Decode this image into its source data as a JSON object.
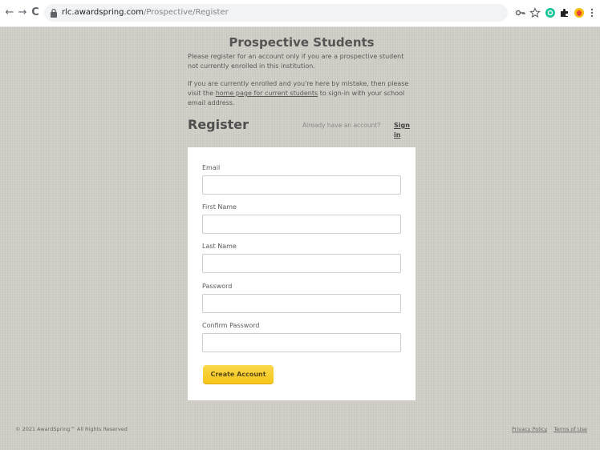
{
  "browser": {
    "back_icon": "←",
    "forward_icon": "→",
    "reload_icon": "C",
    "url_host": "rlc.awardspring.com",
    "url_path": "/Prospective/Register",
    "extensions": [
      "key-icon",
      "star-icon",
      "grammarly-icon",
      "puzzle-icon",
      "avatar-icon",
      "menu-icon"
    ]
  },
  "page": {
    "heading": "Prospective Students",
    "intro": "Please register for an account only if you are a prospective student not currently enrolled in this institution.",
    "enrolled_prefix": "If you are currently enrolled and you're here by mistake, then please visit the ",
    "enrolled_link": "home page for current students",
    "enrolled_suffix": " to sign-in with your school email address."
  },
  "register": {
    "title": "Register",
    "already_text": "Already have an account?",
    "signin_label": "Sign in"
  },
  "form": {
    "fields": [
      {
        "label": "Email",
        "value": ""
      },
      {
        "label": "First Name",
        "value": ""
      },
      {
        "label": "Last Name",
        "value": ""
      },
      {
        "label": "Password",
        "value": ""
      },
      {
        "label": "Confirm Password",
        "value": ""
      }
    ],
    "submit_label": "Create Account"
  },
  "footer": {
    "copyright": "© 2021 AwardSpring™ All Rights Reserved",
    "privacy_label": "Privacy Policy",
    "terms_label": "Terms of Use"
  },
  "colors": {
    "page_bg": "#cfcdc5",
    "button": "#f5c518"
  }
}
